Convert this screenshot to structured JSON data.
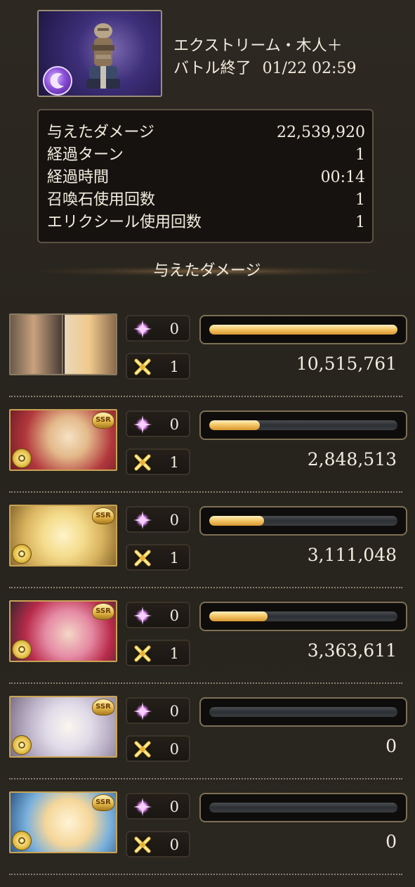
{
  "header": {
    "quest_name": "エクストリーム・木人＋",
    "status": "バトル終了",
    "timestamp": "01/22 02:59"
  },
  "summary": {
    "rows": [
      {
        "label": "与えたダメージ",
        "value": "22,539,920"
      },
      {
        "label": "経過ターン",
        "value": "1"
      },
      {
        "label": "経過時間",
        "value": "00:14"
      },
      {
        "label": "召喚石使用回数",
        "value": "1"
      },
      {
        "label": "エリクシール使用回数",
        "value": "1"
      }
    ]
  },
  "section_title": "与えたダメージ",
  "characters": [
    {
      "ougi_count": "0",
      "skill_count": "1",
      "damage": "10,515,761",
      "bar_fraction": 1.0,
      "rarity": "",
      "is_main": true
    },
    {
      "ougi_count": "0",
      "skill_count": "1",
      "damage": "2,848,513",
      "bar_fraction": 0.27,
      "rarity": "SSR",
      "is_main": false
    },
    {
      "ougi_count": "0",
      "skill_count": "1",
      "damage": "3,111,048",
      "bar_fraction": 0.29,
      "rarity": "SSR",
      "is_main": false
    },
    {
      "ougi_count": "0",
      "skill_count": "1",
      "damage": "3,363,611",
      "bar_fraction": 0.31,
      "rarity": "SSR",
      "is_main": false
    },
    {
      "ougi_count": "0",
      "skill_count": "0",
      "damage": "0",
      "bar_fraction": 0.0,
      "rarity": "SSR",
      "is_main": false
    },
    {
      "ougi_count": "0",
      "skill_count": "0",
      "damage": "0",
      "bar_fraction": 0.0,
      "rarity": "SSR",
      "is_main": false
    }
  ],
  "icons": {
    "ougi": "sparkle-icon",
    "skill": "crossed-swords-icon",
    "element": "wind-element-icon"
  },
  "colors": {
    "bar_gold": "#f4c86a",
    "frame_gold": "#c9a454",
    "background": "#2a2620"
  }
}
